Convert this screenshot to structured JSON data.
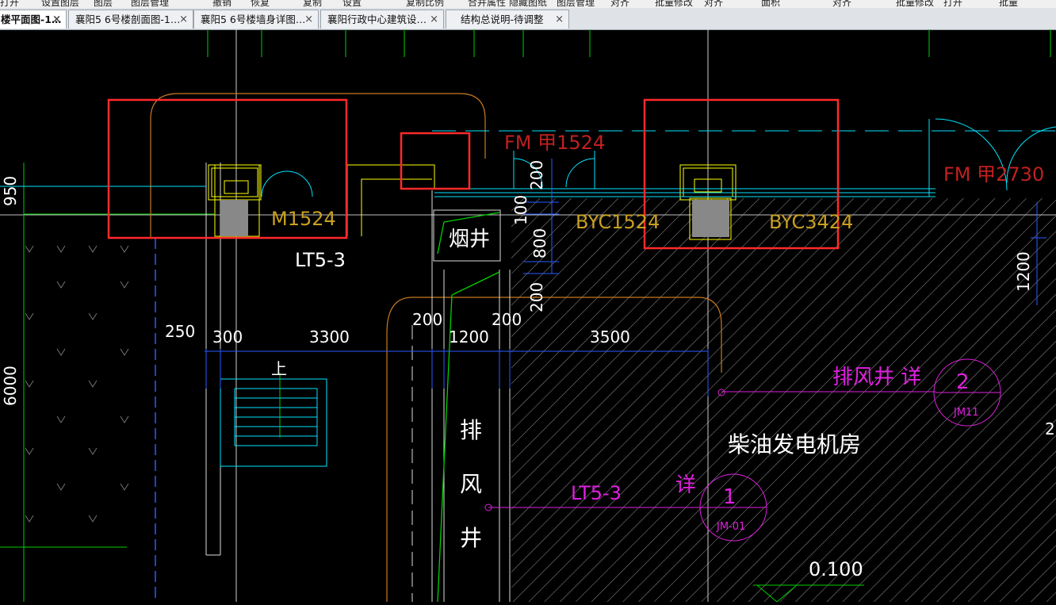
{
  "menu": {
    "items": [
      "打开",
      "设置图层",
      "图层",
      "图层管理",
      "撤销",
      "恢复",
      "复制",
      "设置",
      "复制比例",
      "合并属性",
      "隐藏图纸",
      "图层管理",
      "对齐",
      "批量修改",
      "对齐",
      "面积",
      "对齐",
      "批量修改",
      "打开",
      "批量"
    ]
  },
  "tabs": [
    {
      "label": "楼平面图-1…",
      "close": "×"
    },
    {
      "label": "襄阳5 6号楼剖面图-1…",
      "close": "×"
    },
    {
      "label": "襄阳5 6号楼墙身详图…",
      "close": "×"
    },
    {
      "label": "襄阳行政中心建筑设…",
      "close": "×"
    },
    {
      "label": "结构总说明-待调整",
      "close": "×"
    }
  ],
  "drawing": {
    "labels": {
      "m1524": "M1524",
      "lt5_3_a": "LT5-3",
      "fm_1524": "FM 甲1524",
      "byc1524": "BYC1524",
      "byc3424": "BYC3424",
      "fm_2730": "FM 甲2730",
      "yanjing": "烟井",
      "shang": "上",
      "pai": "排",
      "feng": "风",
      "jing": "井",
      "paifengjing_xiang": "排风井  详",
      "chaiyou": "柴油发电机房",
      "lt5_3_b": "LT5-3",
      "xiang_b": "详",
      "detail_2": "2",
      "detail_1": "1",
      "detail_2_sub": "JM11",
      "detail_1_sub": "JM-01",
      "elev": "0.100"
    },
    "dims": {
      "d950": "950",
      "d6000": "6000",
      "d250": "250",
      "d300": "300",
      "d3300": "3300",
      "d200a": "200",
      "d1200": "1200",
      "d200b": "200",
      "d3500": "3500",
      "d200c": "200",
      "d100": "100",
      "d800": "800",
      "d200d": "200",
      "d1200r": "1200",
      "d2": "2"
    },
    "colors": {
      "background": "#000000",
      "red_highlight": "#ff2a2a",
      "yellow": "#ffff00",
      "orange_text": "#c8a020",
      "cyan": "#00e5ff",
      "blue": "#2a5cff",
      "green": "#00d000",
      "magenta": "#e020e0",
      "white": "#ffffff",
      "dark_red_text": "#c02020"
    }
  }
}
